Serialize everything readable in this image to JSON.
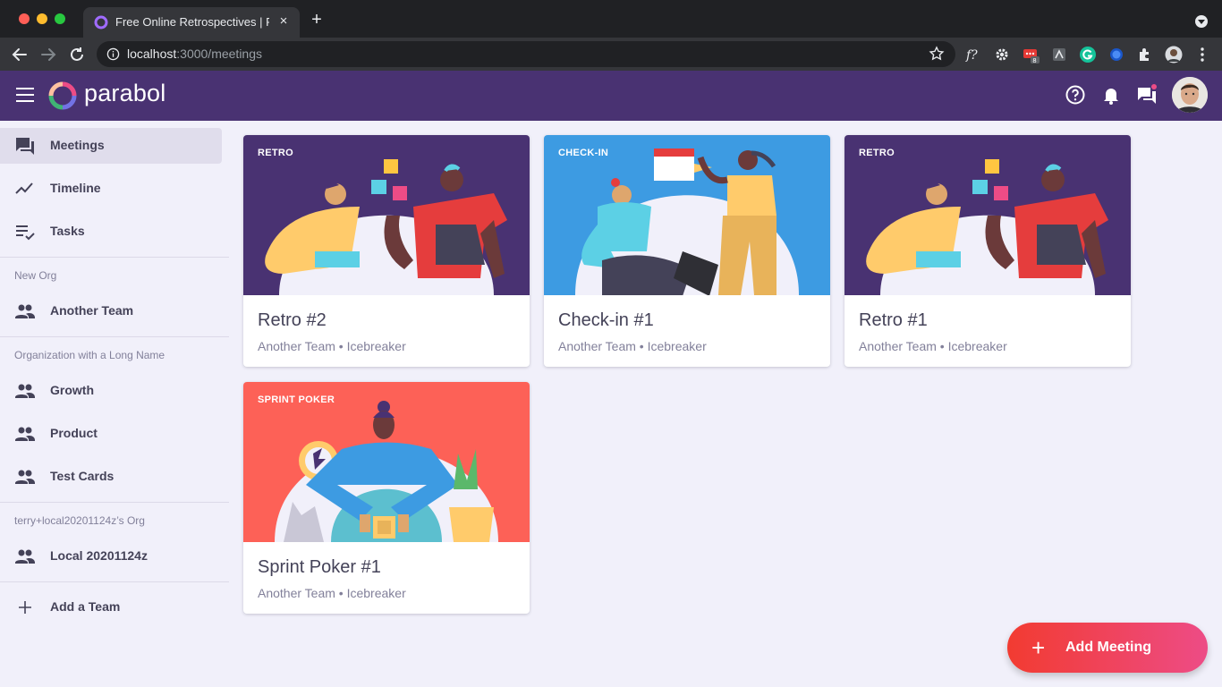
{
  "browser": {
    "tab_title": "Free Online Retrospectives | Parabol",
    "tab_close": "×",
    "new_tab": "+",
    "url_host": "localhost",
    "url_path": ":3000/meetings",
    "extension_badge": "8"
  },
  "app": {
    "logo_text": "parabol",
    "colors": {
      "header": "#493272",
      "accent": "#F23B31",
      "accent_end": "#ED4C86"
    }
  },
  "sidebar": {
    "items": [
      {
        "label": "Meetings",
        "icon": "meetings-icon",
        "active": true
      },
      {
        "label": "Timeline",
        "icon": "timeline-icon"
      },
      {
        "label": "Tasks",
        "icon": "tasks-icon"
      }
    ],
    "orgs": [
      {
        "name": "New Org",
        "teams": [
          "Another Team"
        ]
      },
      {
        "name": "Organization with a Long Name",
        "teams": [
          "Growth",
          "Product",
          "Test Cards"
        ]
      },
      {
        "name": "terry+local20201124z’s Org",
        "teams": [
          "Local 20201124z"
        ]
      }
    ],
    "add_team": "Add a Team"
  },
  "meetings": [
    {
      "type": "RETRO",
      "title": "Retro #2",
      "meta": "Another Team • Icebreaker",
      "bg": "#493272"
    },
    {
      "type": "CHECK-IN",
      "title": "Check-in #1",
      "meta": "Another Team • Icebreaker",
      "bg": "#3D9BE2"
    },
    {
      "type": "RETRO",
      "title": "Retro #1",
      "meta": "Another Team • Icebreaker",
      "bg": "#493272"
    },
    {
      "type": "SPRINT POKER",
      "title": "Sprint Poker #1",
      "meta": "Another Team • Icebreaker",
      "bg": "#FD6157"
    }
  ],
  "fab": {
    "plus": "+",
    "label": "Add Meeting"
  }
}
